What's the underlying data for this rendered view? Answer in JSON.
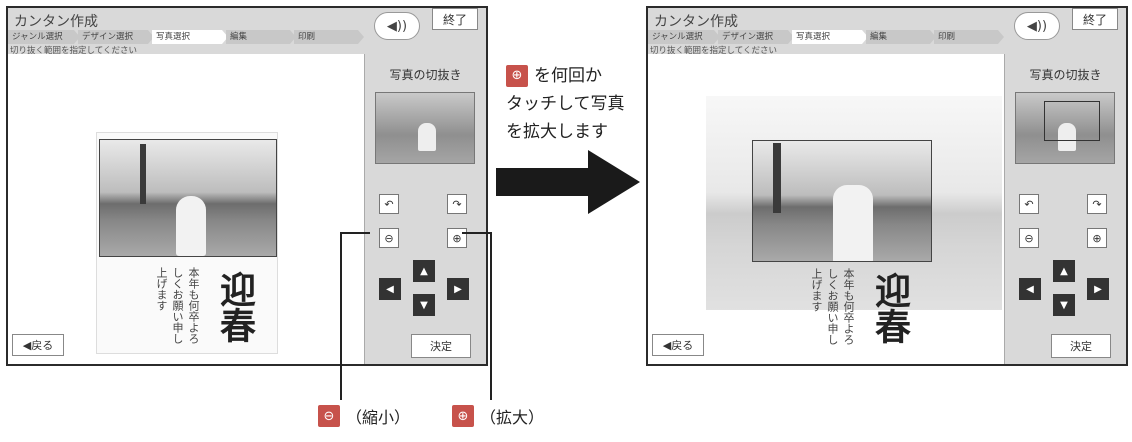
{
  "app": {
    "title": "カンタン作成",
    "steps": [
      "ジャンル選択",
      "デザイン選択",
      "写真選択",
      "編集",
      "印刷"
    ],
    "active_step_index": 2,
    "instruction": "切り抜く範囲を指定してください",
    "sound_icon": "speaker-icon",
    "end_label": "終了",
    "back_label": "◀戻る",
    "decide_label": "決定",
    "panel_title": "写真の切抜き"
  },
  "controls": {
    "rotate_left_icon": "rotate-left-icon",
    "rotate_right_icon": "rotate-right-icon",
    "zoom_out_icon": "zoom-out-icon",
    "zoom_in_icon": "zoom-in-icon",
    "up": "▲",
    "down": "▼",
    "left": "◀",
    "right": "▶"
  },
  "greeting": {
    "main": "迎春",
    "sub": "本年も何卒よろしくお願い申し上げます"
  },
  "caption": {
    "line1": "を何回か",
    "line2": "タッチして写真",
    "line3": "を拡大します"
  },
  "legend": {
    "zoom_out": "（縮小）",
    "zoom_in": "（拡大）"
  },
  "colors": {
    "accent_red": "#c7524b",
    "panel_gray": "#d9d9d9"
  }
}
